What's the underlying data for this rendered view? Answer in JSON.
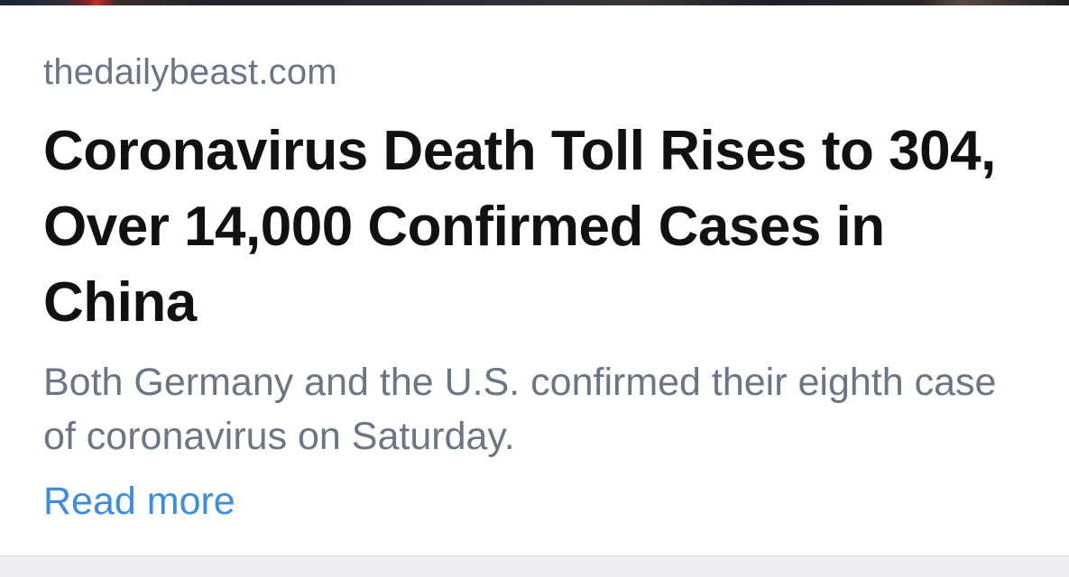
{
  "card": {
    "source": "thedailybeast.com",
    "headline": "Coronavirus Death Toll Rises to 304, Over 14,000 Confirmed Cases in China",
    "summary": "Both Germany and the U.S. confirmed their eighth case of coronavirus on Saturday.",
    "read_more_label": "Read more"
  },
  "colors": {
    "source_text": "#6b7585",
    "headline_text": "#111111",
    "summary_text": "#6b7585",
    "link": "#3a8ee0",
    "footer_background": "#eceef3"
  }
}
